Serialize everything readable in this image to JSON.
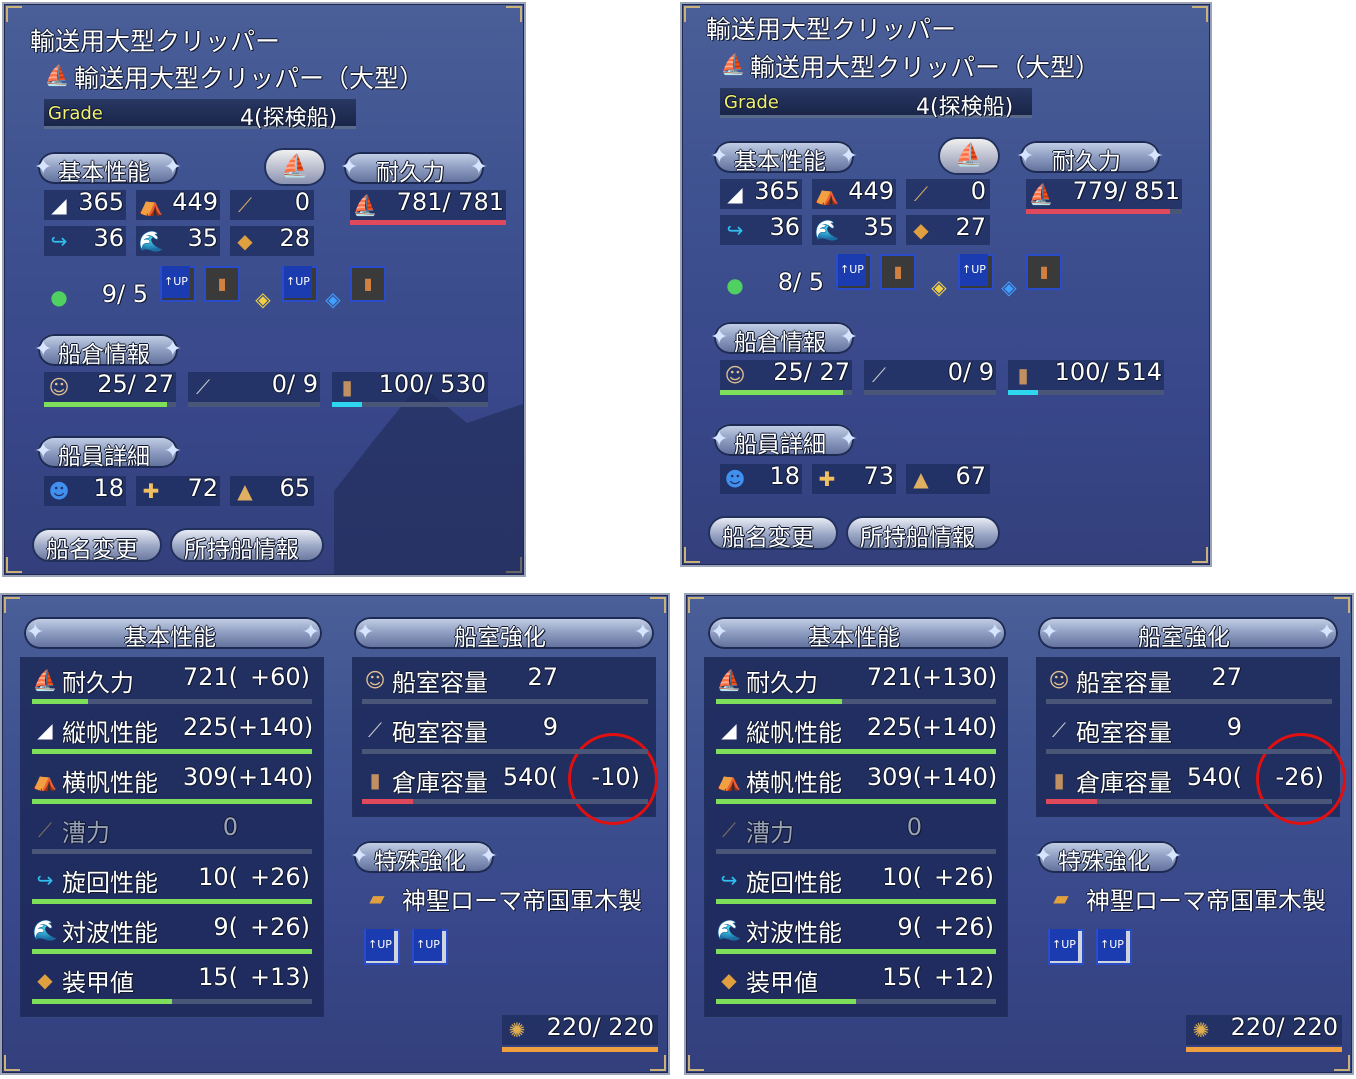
{
  "panel_a": {
    "ship_type": "輸送用大型クリッパー",
    "ship_name": "輸送用大型クリッパー（大型）",
    "grade_label": "Grade",
    "grade_value": "4(探検船)",
    "basic_header": "基本性能",
    "durability_header": "耐久力",
    "sail_v": "365",
    "sail_h": "449",
    "rowing": "0",
    "turning": "36",
    "wave": "35",
    "armor": "28",
    "durability": "781/ 781",
    "durability_fill": 1.0,
    "slots_count": "9/ 5",
    "cargo_header": "船倉情報",
    "crew_cap": "25/ 27",
    "cannon_cap": "0/ 9",
    "storage_cap": "100/ 530",
    "crew_fill": 0.93,
    "cannon_fill": 0,
    "storage_fill": 0.19,
    "crew_detail_header": "船員詳細",
    "crew_a": "18",
    "crew_b": "72",
    "crew_c": "65",
    "rename_btn": "船名変更",
    "owned_btn": "所持船情報"
  },
  "panel_b": {
    "ship_type": "輸送用大型クリッパー",
    "ship_name": "輸送用大型クリッパー（大型）",
    "grade_label": "Grade",
    "grade_value": "4(探検船)",
    "basic_header": "基本性能",
    "durability_header": "耐久力",
    "sail_v": "365",
    "sail_h": "449",
    "rowing": "0",
    "turning": "36",
    "wave": "35",
    "armor": "27",
    "durability": "779/ 851",
    "durability_fill": 0.92,
    "slots_count": "8/ 5",
    "cargo_header": "船倉情報",
    "crew_cap": "25/ 27",
    "cannon_cap": "0/ 9",
    "storage_cap": "100/ 514",
    "crew_fill": 0.93,
    "cannon_fill": 0,
    "storage_fill": 0.19,
    "crew_detail_header": "船員詳細",
    "crew_a": "18",
    "crew_b": "73",
    "crew_c": "67",
    "rename_btn": "船名変更",
    "owned_btn": "所持船情報"
  },
  "panel_c": {
    "basic_header": "基本性能",
    "cabin_header": "船室強化",
    "special_header": "特殊強化",
    "stats": [
      {
        "label": "耐久力",
        "value": "721(",
        "bonus": "+60)",
        "fill": 0.2
      },
      {
        "label": "縦帆性能",
        "value": "225(",
        "bonus": "+140)",
        "fill": 1.0
      },
      {
        "label": "横帆性能",
        "value": "309(",
        "bonus": "+140)",
        "fill": 1.0
      },
      {
        "label": "漕力",
        "value": "0",
        "bonus": "",
        "fill": 0
      },
      {
        "label": "旋回性能",
        "value": "10(",
        "bonus": "+26)",
        "fill": 1.0
      },
      {
        "label": "対波性能",
        "value": "9(",
        "bonus": "+26)",
        "fill": 1.0
      },
      {
        "label": "装甲値",
        "value": "15(",
        "bonus": "+13)",
        "fill": 0.5
      }
    ],
    "cabin": [
      {
        "label": "船室容量",
        "value": "27",
        "bonus": ""
      },
      {
        "label": "砲室容量",
        "value": "9",
        "bonus": ""
      },
      {
        "label": "倉庫容量",
        "value": "540(",
        "bonus": "-10)"
      }
    ],
    "special_item": "神聖ローマ帝国軍木製",
    "sailor_count": "220/ 220"
  },
  "panel_d": {
    "basic_header": "基本性能",
    "cabin_header": "船室強化",
    "special_header": "特殊強化",
    "stats": [
      {
        "label": "耐久力",
        "value": "721(",
        "bonus": "+130)",
        "fill": 0.45
      },
      {
        "label": "縦帆性能",
        "value": "225(",
        "bonus": "+140)",
        "fill": 1.0
      },
      {
        "label": "横帆性能",
        "value": "309(",
        "bonus": "+140)",
        "fill": 1.0
      },
      {
        "label": "漕力",
        "value": "0",
        "bonus": "",
        "fill": 0
      },
      {
        "label": "旋回性能",
        "value": "10(",
        "bonus": "+26)",
        "fill": 1.0
      },
      {
        "label": "対波性能",
        "value": "9(",
        "bonus": "+26)",
        "fill": 1.0
      },
      {
        "label": "装甲値",
        "value": "15(",
        "bonus": "+12)",
        "fill": 0.5
      }
    ],
    "cabin": [
      {
        "label": "船室容量",
        "value": "27",
        "bonus": ""
      },
      {
        "label": "砲室容量",
        "value": "9",
        "bonus": ""
      },
      {
        "label": "倉庫容量",
        "value": "540(",
        "bonus": "-26)"
      }
    ],
    "special_item": "神聖ローマ帝国軍木製",
    "sailor_count": "220/ 220"
  },
  "icons": {
    "ship": "ship-icon",
    "sail_v": "vertical-sail-icon",
    "sail_h": "horizontal-sail-icon",
    "oar": "oar-icon",
    "turn": "turn-arrow-icon",
    "wave": "wave-icon",
    "armor": "armor-plank-icon",
    "crew": "crew-icon",
    "cannon": "cannon-icon",
    "barrel": "barrel-icon",
    "gear": "gear-icon"
  },
  "colors": {
    "bar_green": "#7ee05a",
    "bar_red": "#e0485c",
    "bar_cyan": "#2fd6f0",
    "highlight_circle": "#e01010"
  }
}
